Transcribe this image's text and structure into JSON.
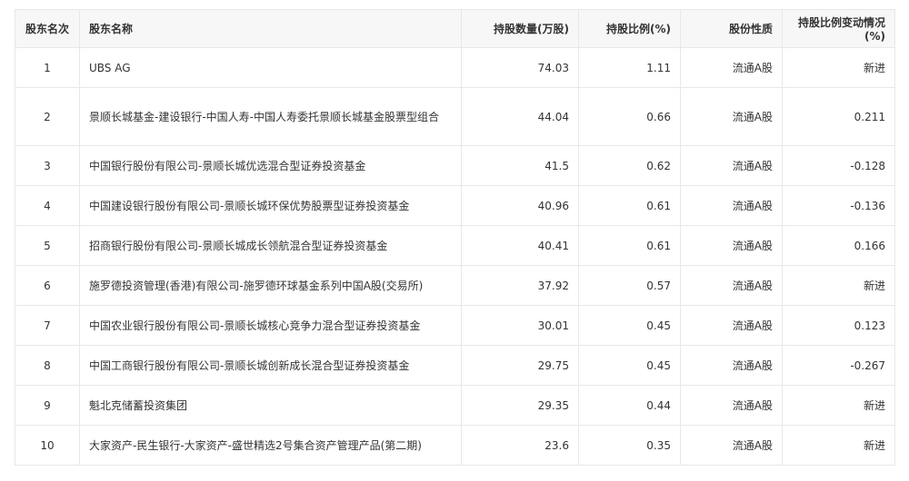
{
  "table": {
    "headers": {
      "rank": "股东名次",
      "name": "股东名称",
      "shares": "持股数量(万股)",
      "ratio": "持股比例(%)",
      "type": "股份性质",
      "change": "持股比例变动情况(%)"
    },
    "rows": [
      {
        "rank": "1",
        "name": "UBS AG",
        "shares": "74.03",
        "ratio": "1.11",
        "type": "流通A股",
        "change": "新进"
      },
      {
        "rank": "2",
        "name": "景顺长城基金-建设银行-中国人寿-中国人寿委托景顺长城基金股票型组合",
        "shares": "44.04",
        "ratio": "0.66",
        "type": "流通A股",
        "change": "0.211"
      },
      {
        "rank": "3",
        "name": "中国银行股份有限公司-景顺长城优选混合型证券投资基金",
        "shares": "41.5",
        "ratio": "0.62",
        "type": "流通A股",
        "change": "-0.128"
      },
      {
        "rank": "4",
        "name": "中国建设银行股份有限公司-景顺长城环保优势股票型证券投资基金",
        "shares": "40.96",
        "ratio": "0.61",
        "type": "流通A股",
        "change": "-0.136"
      },
      {
        "rank": "5",
        "name": "招商银行股份有限公司-景顺长城成长领航混合型证券投资基金",
        "shares": "40.41",
        "ratio": "0.61",
        "type": "流通A股",
        "change": "0.166"
      },
      {
        "rank": "6",
        "name": "施罗德投资管理(香港)有限公司-施罗德环球基金系列中国A股(交易所)",
        "shares": "37.92",
        "ratio": "0.57",
        "type": "流通A股",
        "change": "新进"
      },
      {
        "rank": "7",
        "name": "中国农业银行股份有限公司-景顺长城核心竞争力混合型证券投资基金",
        "shares": "30.01",
        "ratio": "0.45",
        "type": "流通A股",
        "change": "0.123"
      },
      {
        "rank": "8",
        "name": "中国工商银行股份有限公司-景顺长城创新成长混合型证券投资基金",
        "shares": "29.75",
        "ratio": "0.45",
        "type": "流通A股",
        "change": "-0.267"
      },
      {
        "rank": "9",
        "name": "魁北克储蓄投资集团",
        "shares": "29.35",
        "ratio": "0.44",
        "type": "流通A股",
        "change": "新进"
      },
      {
        "rank": "10",
        "name": "大家资产-民生银行-大家资产-盛世精选2号集合资产管理产品(第二期)",
        "shares": "23.6",
        "ratio": "0.35",
        "type": "流通A股",
        "change": "新进"
      }
    ]
  }
}
